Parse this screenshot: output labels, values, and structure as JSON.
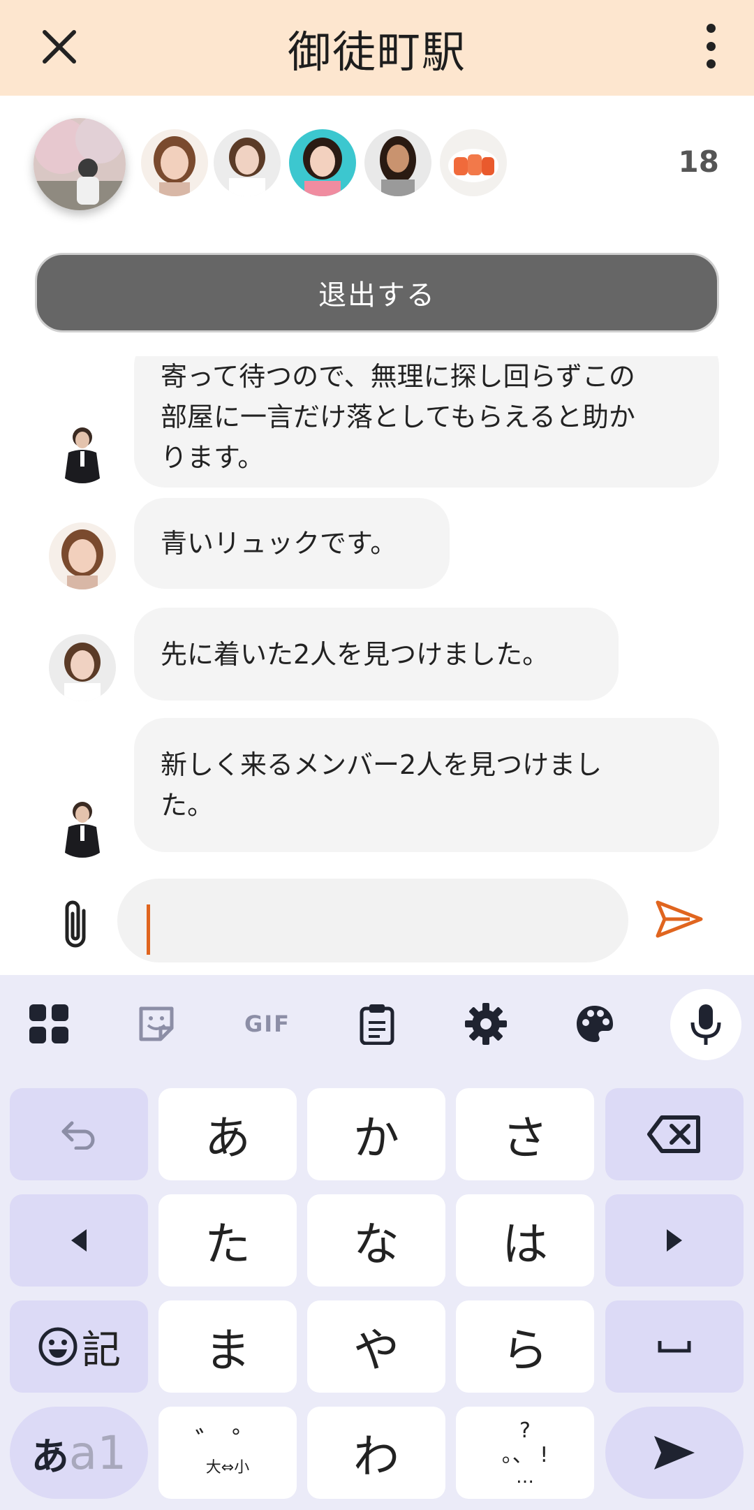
{
  "header": {
    "title": "御徒町駅"
  },
  "members": {
    "count": "18"
  },
  "leave_button": {
    "label": "退出する"
  },
  "messages": [
    {
      "lines": [
        "寄って待つので、無理に探し回らずこの",
        "部屋に一言だけ落としてもらえると助か",
        "ります。"
      ]
    },
    {
      "lines": [
        "青いリュックです。"
      ]
    },
    {
      "lines": [
        "先に着いた2人を見つけました。"
      ]
    },
    {
      "lines": [
        "新しく来るメンバー2人を見つけまし",
        "た。"
      ]
    }
  ],
  "composer": {
    "value": ""
  },
  "keyboard": {
    "toolbar": {
      "gif_label": "GIF"
    },
    "rows": [
      [
        "あ",
        "か",
        "さ"
      ],
      [
        "た",
        "な",
        "は"
      ],
      [
        "ま",
        "や",
        "ら"
      ],
      [
        "わ"
      ]
    ],
    "emoji_key_label": "記",
    "mode_key_label": {
      "kana": "あ",
      "alpha": "a1"
    },
    "dakuten_key_label": {
      "top": "゛ ゜",
      "bottom": "大⇔小"
    },
    "punct_key_label": {
      "top": "?",
      "mid": "。、 !",
      "bottom": "…"
    }
  },
  "colors": {
    "header_bg": "#fde6cf",
    "accent": "#e0651f",
    "keyboard_bg": "#ebebf8",
    "fn_key": "#dcdaf6"
  }
}
